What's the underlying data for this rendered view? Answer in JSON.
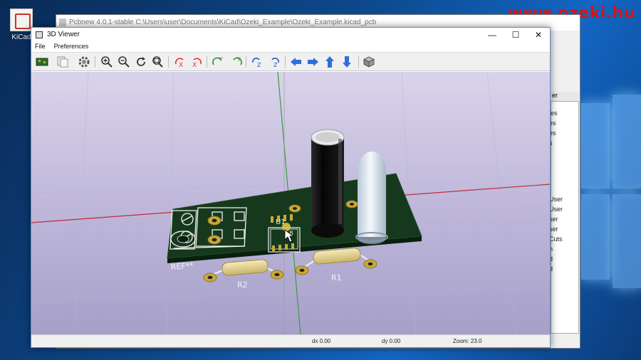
{
  "desktop": {
    "icon_label": "KiCad",
    "watermark": "www.ozeki.hu"
  },
  "pcbnew": {
    "title": "Pcbnew 4.0.1-stable C:\\Users\\user\\Documents\\KiCad\\Ozeki_Example\\Ozeki_Example.kicad_pcb",
    "panel_tab": "er",
    "panel_items": [
      "les",
      "es",
      "es",
      "s",
      "User",
      "User",
      "ser",
      "ser",
      "Cuts",
      "n",
      "d",
      "d"
    ]
  },
  "viewer": {
    "title": "3D Viewer",
    "window_controls": {
      "minimize": "—",
      "maximize": "☐",
      "close": "✕"
    },
    "menu": [
      "File",
      "Preferences"
    ],
    "toolbar": [
      "reload-board-icon",
      "copy-clipboard-icon",
      "settings-icon",
      "zoom-in-icon",
      "zoom-out-icon",
      "redraw-icon",
      "zoom-fit-icon",
      "rotate-x-cw-icon",
      "rotate-x-ccw-icon",
      "rotate-y-cw-icon",
      "rotate-y-ccw-icon",
      "rotate-z-cw-icon",
      "rotate-z-ccw-icon",
      "move-left-icon",
      "move-right-icon",
      "move-up-icon",
      "move-down-icon",
      "orthographic-icon"
    ],
    "board": {
      "u1": "U1",
      "ref": "REF**",
      "r1": "R1",
      "r2": "R2",
      "silkscreen_num": "8"
    },
    "status": {
      "dx": "dx 0.00",
      "dy": "dy 0.00",
      "zoom": "Zoom: 23.0"
    }
  },
  "colors": {
    "board": "#16391d",
    "silkscreen": "#f2f2f2",
    "pad": "#c9a93a",
    "capacitor": "#0d0d0d",
    "resistor": "#e6d38a",
    "led": "#dde8f2",
    "axis_red": "#c22a3a",
    "axis_green": "#3b9b3b"
  }
}
